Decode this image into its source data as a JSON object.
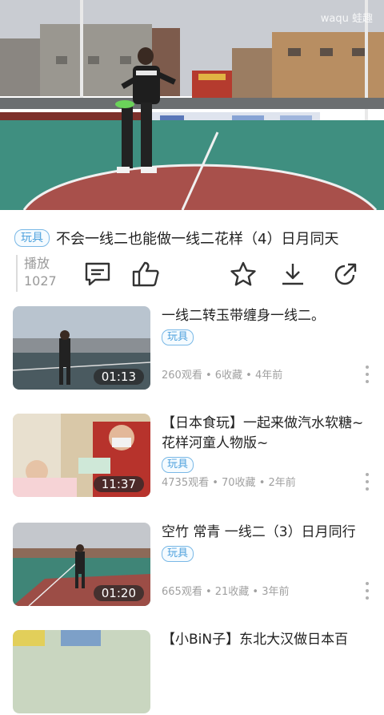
{
  "player": {
    "watermark": "waqu 蛙趣"
  },
  "video": {
    "tag": "玩具",
    "title": "不会一线二也能做一线二花样（4）日月同天",
    "plays_label": "播放",
    "plays_count": "1027"
  },
  "actions": [
    "comment-icon",
    "like-icon",
    "favorite-star-icon",
    "download-icon",
    "share-icon"
  ],
  "recommendations": [
    {
      "title": "一线二转玉带缠身一线二。",
      "tag": "玩具",
      "meta": "260观看 • 6收藏 • 4年前",
      "duration": "01:13"
    },
    {
      "title": "【日本食玩】一起来做汽水软糖~花样河童人物版~",
      "tag": "玩具",
      "meta": "4735观看 • 70收藏 • 2年前",
      "duration": "11:37"
    },
    {
      "title": "空竹 常青 一线二（3）日月同行",
      "tag": "玩具",
      "meta": "665观看 • 21收藏 • 3年前",
      "duration": "01:20"
    },
    {
      "title": "【小BiN子】东北大汉做日本百",
      "tag": "",
      "meta": "",
      "duration": ""
    }
  ],
  "colors": {
    "accent": "#4fa2dd",
    "court_green": "#3f8f80",
    "court_red": "#a8504b"
  }
}
